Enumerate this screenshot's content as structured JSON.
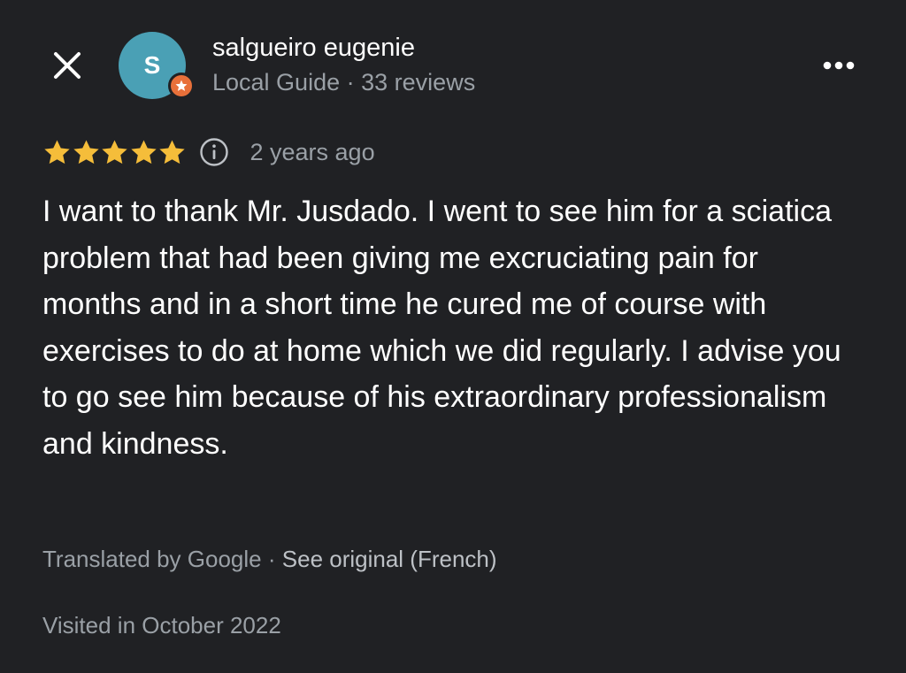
{
  "header": {
    "close_icon": "close-icon",
    "more_icon": "more-options-icon",
    "reviewer": {
      "name": "salgueiro eugenie",
      "avatar_initial": "S",
      "avatar_color": "#4aa0b5",
      "badge_color": "#e8703a",
      "badge_icon": "star-badge-icon",
      "role": "Local Guide",
      "separator": "·",
      "review_count": "33 reviews"
    }
  },
  "review": {
    "rating": 5,
    "rating_max": 5,
    "star_color": "#f5bd3a",
    "info_icon": "info-icon",
    "time_ago": "2 years ago",
    "text": "I want to thank Mr. Jusdado. I went to see him for a sciatica problem that had been giving me excruciating pain for months and in a short time he cured me of course with exercises to do at home which we did regularly. I advise you to go see him because of his extraordinary professionalism and kindness.",
    "translation_note": "Translated by Google",
    "translation_separator": "·",
    "see_original_label": "See original (French)",
    "visited": "Visited in October 2022"
  }
}
